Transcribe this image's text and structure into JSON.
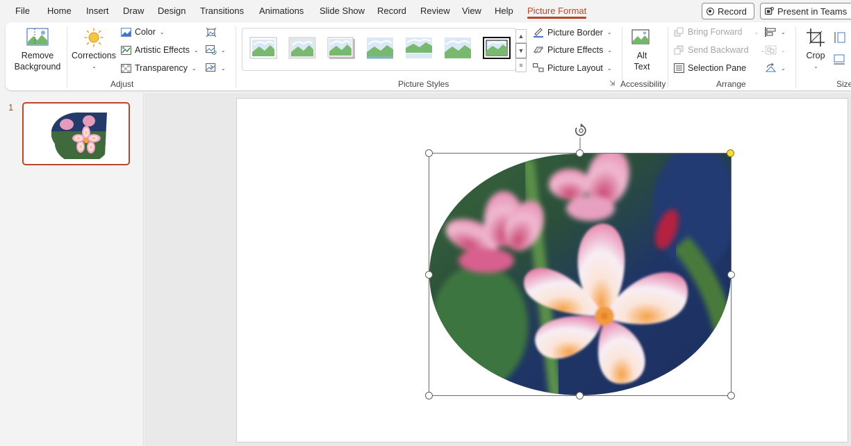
{
  "menu": {
    "tabs": [
      {
        "label": "File"
      },
      {
        "label": "Home"
      },
      {
        "label": "Insert"
      },
      {
        "label": "Draw"
      },
      {
        "label": "Design"
      },
      {
        "label": "Transitions"
      },
      {
        "label": "Animations"
      },
      {
        "label": "Slide Show"
      },
      {
        "label": "Record"
      },
      {
        "label": "Review"
      },
      {
        "label": "View"
      },
      {
        "label": "Help"
      },
      {
        "label": "Picture Format"
      }
    ],
    "active_tab": "Picture Format",
    "record_button": "Record",
    "present_button": "Present in Teams"
  },
  "ribbon": {
    "adjust": {
      "remove_background": [
        "Remove",
        "Background"
      ],
      "corrections": "Corrections",
      "color": "Color",
      "artistic_effects": "Artistic Effects",
      "transparency": "Transparency",
      "group_label": "Adjust"
    },
    "picture_styles": {
      "picture_border": "Picture Border",
      "picture_effects": "Picture Effects",
      "picture_layout": "Picture Layout",
      "group_label": "Picture Styles"
    },
    "accessibility": {
      "alt_text": [
        "Alt",
        "Text"
      ],
      "group_label": "Accessibility"
    },
    "arrange": {
      "bring_forward": "Bring Forward",
      "send_backward": "Send Backward",
      "selection_pane": "Selection Pane",
      "group_label": "Arrange"
    },
    "crop": "Crop",
    "size_group_label": "Size"
  },
  "thumbnails": {
    "slide_number": "1"
  },
  "colors": {
    "accent": "#b7472a",
    "selection_handle_adjust": "#f5dd3c"
  }
}
